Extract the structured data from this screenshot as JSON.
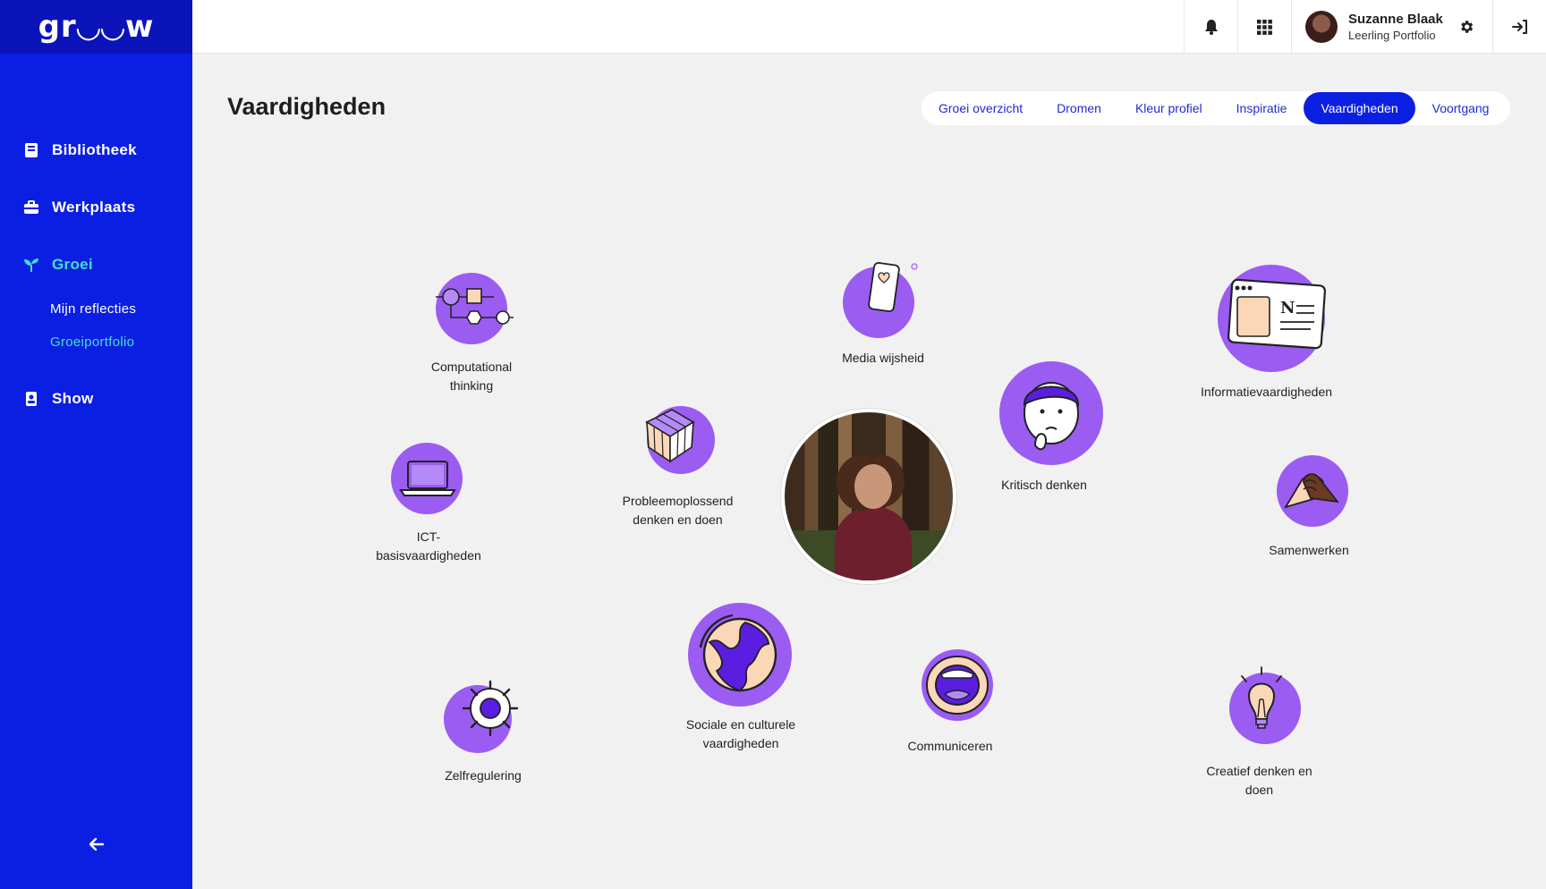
{
  "brand": {
    "logo_text": "gr◡◡w"
  },
  "sidebar": {
    "items": [
      {
        "label": "Bibliotheek",
        "icon": "book-icon"
      },
      {
        "label": "Werkplaats",
        "icon": "toolbox-icon"
      },
      {
        "label": "Groei",
        "icon": "sprout-icon"
      },
      {
        "label": "Show",
        "icon": "badge-icon"
      }
    ],
    "sub_items": [
      {
        "label": "Mijn reflecties"
      },
      {
        "label": "Groeiportfolio"
      }
    ]
  },
  "topbar": {
    "user_name": "Suzanne Blaak",
    "user_role": "Leerling Portfolio"
  },
  "page": {
    "title": "Vaardigheden"
  },
  "tabs": [
    {
      "label": "Groei overzicht"
    },
    {
      "label": "Dromen"
    },
    {
      "label": "Kleur profiel"
    },
    {
      "label": "Inspiratie"
    },
    {
      "label": "Vaardigheden"
    },
    {
      "label": "Voortgang"
    }
  ],
  "skills": {
    "computational": {
      "label": "Computational thinking",
      "icon": "flowchart-icon"
    },
    "media": {
      "label": "Media wijsheid",
      "icon": "smartphone-icon"
    },
    "informatie": {
      "label": "Informatievaardigheden",
      "icon": "newspaper-icon"
    },
    "probleem": {
      "label": "Probleemoplossend denken en doen",
      "icon": "rubiks-cube-icon"
    },
    "kritisch": {
      "label": "Kritisch denken",
      "icon": "thinking-face-icon"
    },
    "ict": {
      "label": "ICT-basisvaardigheden",
      "icon": "laptop-icon"
    },
    "samenwerken": {
      "label": "Samenwerken",
      "icon": "handshake-icon"
    },
    "sociale": {
      "label": "Sociale en culturele vaardigheden",
      "icon": "globe-icon"
    },
    "zelfregulering": {
      "label": "Zelfregulering",
      "icon": "ship-wheel-icon"
    },
    "communiceren": {
      "label": "Communiceren",
      "icon": "mouth-icon"
    },
    "creatief": {
      "label": "Creatief denken en doen",
      "icon": "lightbulb-icon"
    }
  },
  "colors": {
    "sidebar": "#0b1fe3",
    "accent": "#41e1c8",
    "skill_purple": "#9b5cf2",
    "skill_light": "#b48af7"
  }
}
